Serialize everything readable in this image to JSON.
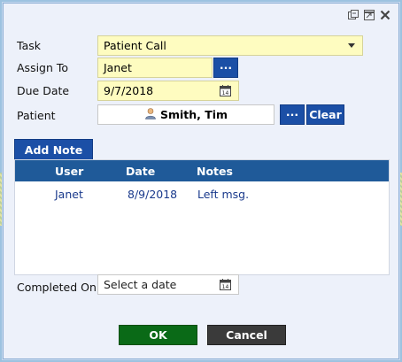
{
  "window": {
    "icons": [
      "restore-icon",
      "maximize-icon",
      "close-icon"
    ]
  },
  "form": {
    "task_label": "Task",
    "task_value": "Patient Call",
    "assign_label": "Assign To",
    "assign_value": "Janet",
    "assign_button": "...",
    "due_label": "Due Date",
    "due_value": "9/7/2018",
    "patient_label": "Patient",
    "patient_value": "Smith, Tim",
    "patient_button": "...",
    "clear_button": "Clear"
  },
  "notes": {
    "add_button": "Add Note",
    "columns": [
      "User",
      "Date",
      "Notes"
    ],
    "rows": [
      {
        "user": "Janet",
        "date": "8/9/2018",
        "note": "Left msg."
      }
    ]
  },
  "completed": {
    "label": "Completed On",
    "placeholder": "Select a date"
  },
  "actions": {
    "ok": "OK",
    "cancel": "Cancel"
  },
  "colors": {
    "accent_blue": "#1b4fa6",
    "header_blue": "#1f5a99",
    "ok_green": "#0a6a17",
    "cancel_dark": "#3a3a3a",
    "field_yellow": "#fefcc0"
  }
}
